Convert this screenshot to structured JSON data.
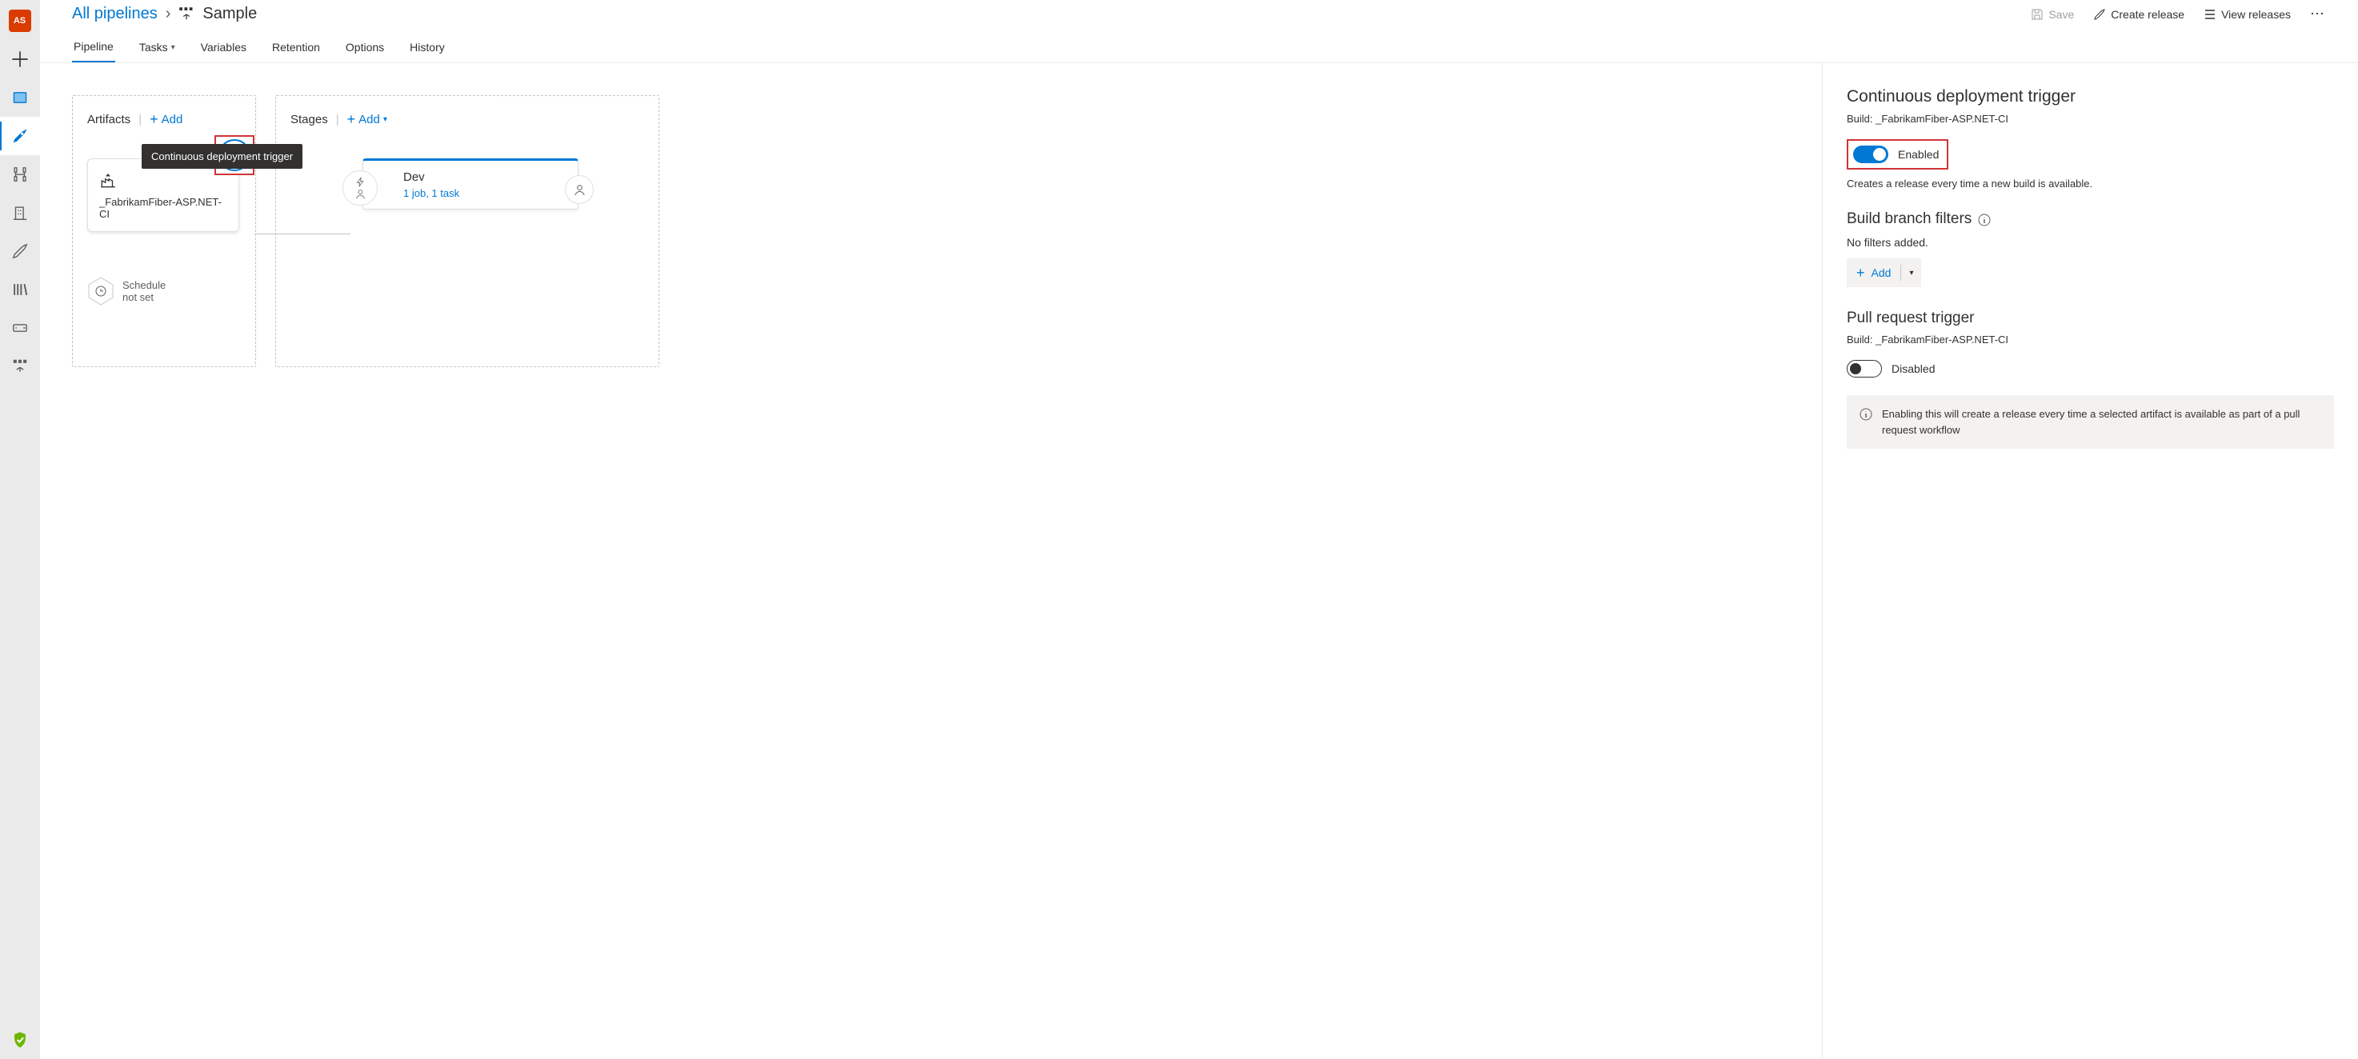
{
  "avatar": "AS",
  "breadcrumb": {
    "root": "All pipelines",
    "name": "Sample"
  },
  "top_actions": {
    "save": "Save",
    "create_release": "Create release",
    "view_releases": "View releases"
  },
  "tabs": {
    "pipeline": "Pipeline",
    "tasks": "Tasks",
    "variables": "Variables",
    "retention": "Retention",
    "options": "Options",
    "history": "History"
  },
  "canvas": {
    "artifacts_title": "Artifacts",
    "stages_title": "Stages",
    "add": "Add",
    "tooltip": "Continuous deployment trigger",
    "artifact_name": "_FabrikamFiber-ASP.NET-CI",
    "schedule_l1": "Schedule",
    "schedule_l2": "not set",
    "stage_name": "Dev",
    "stage_sub": "1 job, 1 task"
  },
  "panel": {
    "cd_title": "Continuous deployment trigger",
    "build_label": "Build: _FabrikamFiber-ASP.NET-CI",
    "enabled": "Enabled",
    "cd_desc": "Creates a release every time a new build is available.",
    "branch_filters": "Build branch filters",
    "no_filters": "No filters added.",
    "add": "Add",
    "pr_title": "Pull request trigger",
    "pr_build_label": "Build: _FabrikamFiber-ASP.NET-CI",
    "disabled": "Disabled",
    "pr_info": "Enabling this will create a release every time a selected artifact is available as part of a pull request workflow"
  }
}
